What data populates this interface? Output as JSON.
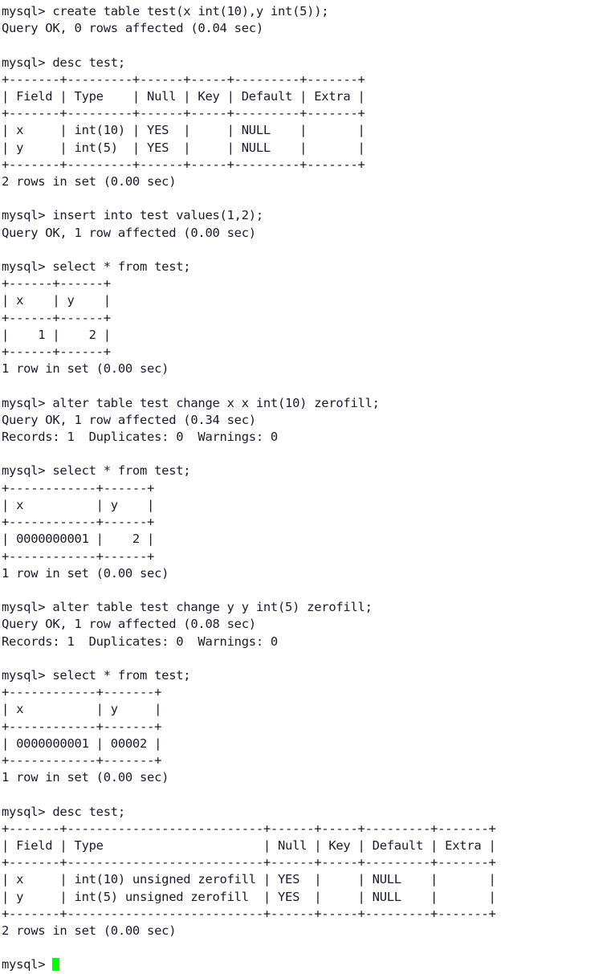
{
  "terminal": {
    "prompt": "mysql>",
    "foreground_color": "#1a1a2e",
    "background_color": "#ffffff",
    "cursor_color": "#00ff00",
    "cursor_name": "block-cursor",
    "lines": [
      "mysql> create table test(x int(10),y int(5));",
      "Query OK, 0 rows affected (0.04 sec)",
      "",
      "mysql> desc test;",
      "+-------+---------+------+-----+---------+-------+",
      "| Field | Type    | Null | Key | Default | Extra |",
      "+-------+---------+------+-----+---------+-------+",
      "| x     | int(10) | YES  |     | NULL    |       |",
      "| y     | int(5)  | YES  |     | NULL    |       |",
      "+-------+---------+------+-----+---------+-------+",
      "2 rows in set (0.00 sec)",
      "",
      "mysql> insert into test values(1,2);",
      "Query OK, 1 row affected (0.00 sec)",
      "",
      "mysql> select * from test;",
      "+------+------+",
      "| x    | y    |",
      "+------+------+",
      "|    1 |    2 |",
      "+------+------+",
      "1 row in set (0.00 sec)",
      "",
      "mysql> alter table test change x x int(10) zerofill;",
      "Query OK, 1 row affected (0.34 sec)",
      "Records: 1  Duplicates: 0  Warnings: 0",
      "",
      "mysql> select * from test;",
      "+------------+------+",
      "| x          | y    |",
      "+------------+------+",
      "| 0000000001 |    2 |",
      "+------------+------+",
      "1 row in set (0.00 sec)",
      "",
      "mysql> alter table test change y y int(5) zerofill;",
      "Query OK, 1 row affected (0.08 sec)",
      "Records: 1  Duplicates: 0  Warnings: 0",
      "",
      "mysql> select * from test;",
      "+------------+-------+",
      "| x          | y     |",
      "+------------+-------+",
      "| 0000000001 | 00002 |",
      "+------------+-------+",
      "1 row in set (0.00 sec)",
      "",
      "mysql> desc test;",
      "+-------+---------------------------+------+-----+---------+-------+",
      "| Field | Type                      | Null | Key | Default | Extra |",
      "+-------+---------------------------+------+-----+---------+-------+",
      "| x     | int(10) unsigned zerofill | YES  |     | NULL    |       |",
      "| y     | int(5) unsigned zerofill  | YES  |     | NULL    |       |",
      "+-------+---------------------------+------+-----+---------+-------+",
      "2 rows in set (0.00 sec)",
      "",
      "mysql> "
    ],
    "commands": [
      "create table test(x int(10),y int(5));",
      "desc test;",
      "insert into test values(1,2);",
      "select * from test;",
      "alter table test change x x int(10) zerofill;",
      "select * from test;",
      "alter table test change y y int(5) zerofill;",
      "select * from test;",
      "desc test;"
    ],
    "result_tables": [
      {
        "name": "desc-test-initial",
        "columns": [
          "Field",
          "Type",
          "Null",
          "Key",
          "Default",
          "Extra"
        ],
        "rows": [
          [
            "x",
            "int(10)",
            "YES",
            "",
            "NULL",
            ""
          ],
          [
            "y",
            "int(5)",
            "YES",
            "",
            "NULL",
            ""
          ]
        ],
        "footer": "2 rows in set (0.00 sec)"
      },
      {
        "name": "select-test-initial",
        "columns": [
          "x",
          "y"
        ],
        "rows": [
          [
            "1",
            "2"
          ]
        ],
        "footer": "1 row in set (0.00 sec)"
      },
      {
        "name": "select-test-x-zerofill",
        "columns": [
          "x",
          "y"
        ],
        "rows": [
          [
            "0000000001",
            "2"
          ]
        ],
        "footer": "1 row in set (0.00 sec)"
      },
      {
        "name": "select-test-xy-zerofill",
        "columns": [
          "x",
          "y"
        ],
        "rows": [
          [
            "0000000001",
            "00002"
          ]
        ],
        "footer": "1 row in set (0.00 sec)"
      },
      {
        "name": "desc-test-final",
        "columns": [
          "Field",
          "Type",
          "Null",
          "Key",
          "Default",
          "Extra"
        ],
        "rows": [
          [
            "x",
            "int(10) unsigned zerofill",
            "YES",
            "",
            "NULL",
            ""
          ],
          [
            "y",
            "int(5) unsigned zerofill",
            "YES",
            "",
            "NULL",
            ""
          ]
        ],
        "footer": "2 rows in set (0.00 sec)"
      }
    ],
    "status_messages": [
      "Query OK, 0 rows affected (0.04 sec)",
      "Query OK, 1 row affected (0.00 sec)",
      "Query OK, 1 row affected (0.34 sec)",
      "Records: 1  Duplicates: 0  Warnings: 0",
      "Query OK, 1 row affected (0.08 sec)",
      "Records: 1  Duplicates: 0  Warnings: 0"
    ]
  }
}
